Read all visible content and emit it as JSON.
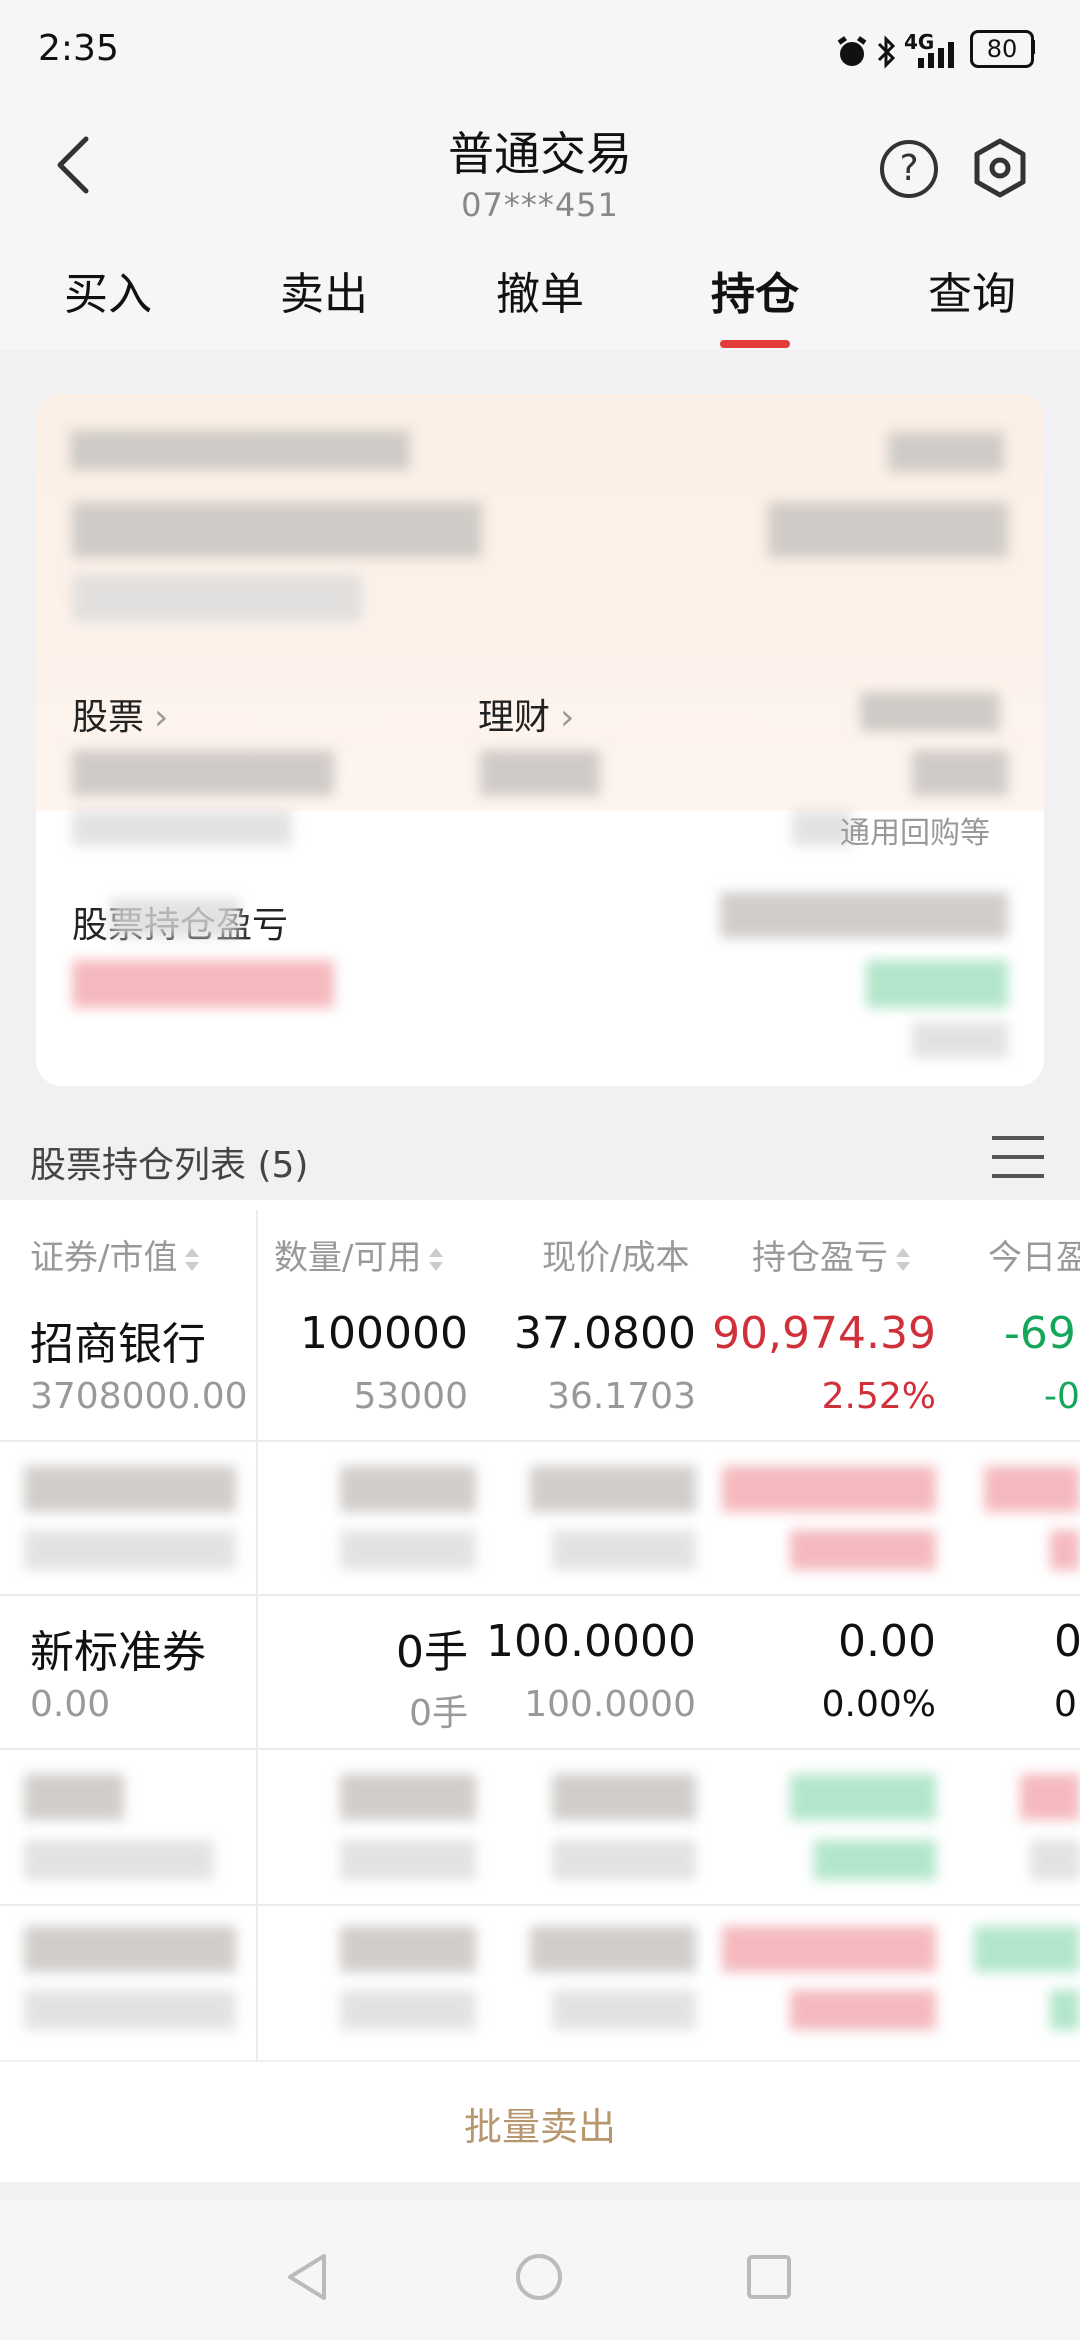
{
  "status_bar": {
    "time": "2:35",
    "battery": "80",
    "network": "4G"
  },
  "header": {
    "title": "普通交易",
    "account": "07***451",
    "help_glyph": "?"
  },
  "tabs": [
    {
      "label": "买入",
      "active": false
    },
    {
      "label": "卖出",
      "active": false
    },
    {
      "label": "撤单",
      "active": false
    },
    {
      "label": "持仓",
      "active": true
    },
    {
      "label": "查询",
      "active": false
    }
  ],
  "colors": {
    "accent": "#e33a3a",
    "loss": "#14a65a",
    "gain": "#d0303a",
    "batch": "#b8966e"
  },
  "assets_card": {
    "stock_label": "股票",
    "finance_label": "理财",
    "repo_hint": "通用回购等",
    "position_pnl_label": "股票持仓盈亏"
  },
  "holdings": {
    "title": "股票持仓列表 (5)",
    "columns": [
      "证券/市值",
      "数量/可用",
      "现价/成本",
      "持仓盈亏",
      "今日盈"
    ],
    "rows": [
      {
        "name": "招商银行",
        "market_value": "3708000.00",
        "quantity": "100000",
        "available": "53000",
        "price": "37.0800",
        "cost": "36.1703",
        "pnl": "90,974.39",
        "pnl_pct": "2.52%",
        "today_pnl": "-69",
        "today_pct": "-0"
      },
      {
        "name": "新标准券",
        "market_value": "0.00",
        "quantity": "0手",
        "available": "0手",
        "price": "100.0000",
        "cost": "100.0000",
        "pnl": "0.00",
        "pnl_pct": "0.00%",
        "today_pnl": "0",
        "today_pct": "0"
      }
    ]
  },
  "batch_sell": "批量卖出",
  "icons": [
    "alarm-icon",
    "bluetooth-icon",
    "signal-icon",
    "battery-icon",
    "back-icon",
    "help-icon",
    "settings-icon",
    "menu-icon",
    "sort-icon",
    "nav-back-icon",
    "nav-home-icon",
    "nav-recent-icon"
  ]
}
